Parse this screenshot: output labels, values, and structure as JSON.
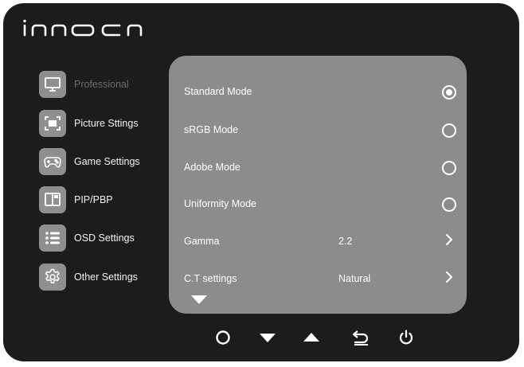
{
  "brand": {
    "logo_text": "INNOCN"
  },
  "sidebar": {
    "items": [
      {
        "label": "Professional",
        "icon": "monitor-icon",
        "enabled": false
      },
      {
        "label": "Picture Sttings",
        "icon": "picture-frame-icon",
        "enabled": true
      },
      {
        "label": "Game Settings",
        "icon": "gamepad-icon",
        "enabled": true
      },
      {
        "label": "PIP/PBP",
        "icon": "pip-icon",
        "enabled": true
      },
      {
        "label": "OSD Settings",
        "icon": "list-icon",
        "enabled": true
      },
      {
        "label": "Other Settings",
        "icon": "gear-icon",
        "enabled": true
      }
    ]
  },
  "panel": {
    "rows": [
      {
        "label": "Standard Mode",
        "control": "radio",
        "selected": true
      },
      {
        "label": "sRGB Mode",
        "control": "radio",
        "selected": false
      },
      {
        "label": "Adobe Mode",
        "control": "radio",
        "selected": false
      },
      {
        "label": "Uniformity Mode",
        "control": "radio",
        "selected": false
      },
      {
        "label": "Gamma",
        "value": "2.2",
        "control": "submenu"
      },
      {
        "label": "C.T settings",
        "value": "Natural",
        "control": "submenu"
      }
    ],
    "more_indicator": "chevron-down-icon"
  },
  "bottom_buttons": [
    {
      "name": "ok-button",
      "icon": "circle-icon"
    },
    {
      "name": "down-button",
      "icon": "triangle-down-icon"
    },
    {
      "name": "up-button",
      "icon": "triangle-up-icon"
    },
    {
      "name": "back-button",
      "icon": "return-arrow-icon"
    },
    {
      "name": "power-button",
      "icon": "power-icon"
    }
  ],
  "colors": {
    "background": "#1c1c1c",
    "panel": "#8c8c8c",
    "icon_tile": "#8f8f8f",
    "text": "#ffffff",
    "disabled_text": "#6d6d6d"
  }
}
